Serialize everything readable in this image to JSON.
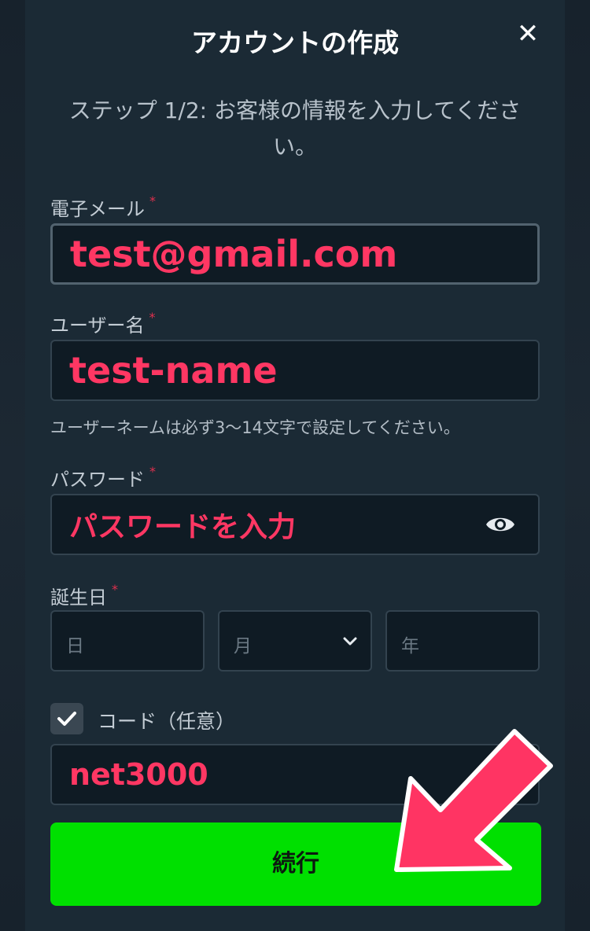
{
  "modal": {
    "title": "アカウントの作成",
    "close_label": "✕",
    "subtitle": "ステップ 1/2: お客様の情報を入力してください。"
  },
  "form": {
    "email": {
      "label": "電子メール",
      "required_mark": "*",
      "value": "test@gmail.com"
    },
    "username": {
      "label": "ユーザー名",
      "required_mark": "*",
      "value": "test-name",
      "hint": "ユーザーネームは必ず3〜14文字で設定してください。"
    },
    "password": {
      "label": "パスワード",
      "required_mark": "*",
      "value": "パスワードを入力"
    },
    "birthdate": {
      "label": "誕生日",
      "required_mark": "*",
      "day_placeholder": "日",
      "month_placeholder": "月",
      "year_placeholder": "年"
    },
    "code": {
      "checkbox_label": "コード（任意）",
      "checked": true,
      "value": "net3000"
    },
    "submit_label": "続行"
  },
  "colors": {
    "background": "#1b2a35",
    "field_bg": "#0f1b24",
    "annotation_text": "#ff3763",
    "submit_button": "#00e000",
    "arrow": "#ff3463"
  },
  "icons": [
    "close-icon",
    "eye-icon",
    "chevron-down-icon",
    "checkmark-icon",
    "arrow-pointer-icon"
  ]
}
